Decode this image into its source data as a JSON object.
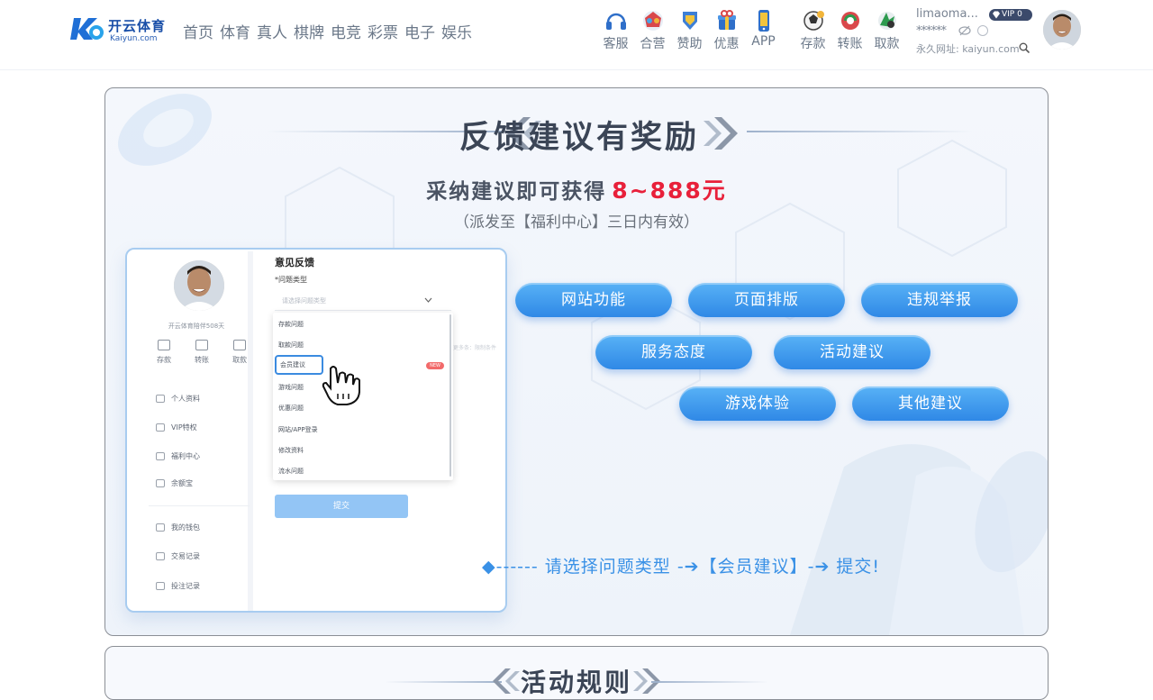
{
  "header": {
    "logo_cn": "开云体育",
    "logo_en": "Kaiyun.com",
    "nav": [
      "首页",
      "体育",
      "真人",
      "棋牌",
      "电竞",
      "彩票",
      "电子",
      "娱乐"
    ],
    "tools": [
      {
        "label": "客服",
        "icon": "headset-icon"
      },
      {
        "label": "合营",
        "icon": "partner-icon"
      },
      {
        "label": "赞助",
        "icon": "sponsor-icon"
      },
      {
        "label": "优惠",
        "icon": "promo-icon"
      },
      {
        "label": "APP",
        "icon": "phone-icon"
      },
      {
        "label": "存款",
        "icon": "deposit-icon"
      },
      {
        "label": "转账",
        "icon": "transfer-icon"
      },
      {
        "label": "取款",
        "icon": "withdraw-icon"
      }
    ],
    "user": {
      "username": "limaoma...",
      "vip": "VIP 0",
      "balance": "******",
      "site_url": "永久网址: kaiyun.com"
    }
  },
  "banner": {
    "title": "反馈建议有奖励",
    "subtitle_prefix": "采纳建议即可获得",
    "subtitle_amount": "8~888元",
    "note": "（派发至【福利中心】三日内有效）",
    "instruction": "◆------ 请选择问题类型 -➔【会员建议】-➔ 提交!"
  },
  "mockup": {
    "days": "开云体育陪伴508天",
    "actions": [
      "存款",
      "转账",
      "取款"
    ],
    "menu": [
      "个人资料",
      "VIP特权",
      "福利中心",
      "余额宝",
      "我的钱包",
      "交易记录",
      "投注记录"
    ],
    "feedback_title": "意见反馈",
    "type_label": "*问题类型",
    "select_placeholder": "请选择问题类型",
    "options": [
      "存款问题",
      "取款问题",
      "会员建议",
      "游戏问题",
      "优惠问题",
      "网站/APP登录",
      "修改资料",
      "流水问题"
    ],
    "new_badge": "NEW",
    "faded_text": "更多条：限制条件",
    "submit": "提交"
  },
  "categories": [
    "网站功能",
    "页面排版",
    "违规举报",
    "服务态度",
    "活动建议",
    "游戏体验",
    "其他建议"
  ],
  "rules": {
    "title": "活动规则"
  },
  "colors": {
    "accent": "#2f88e6",
    "amount": "#e8203a",
    "vip_badge": "#3b4a6b"
  }
}
